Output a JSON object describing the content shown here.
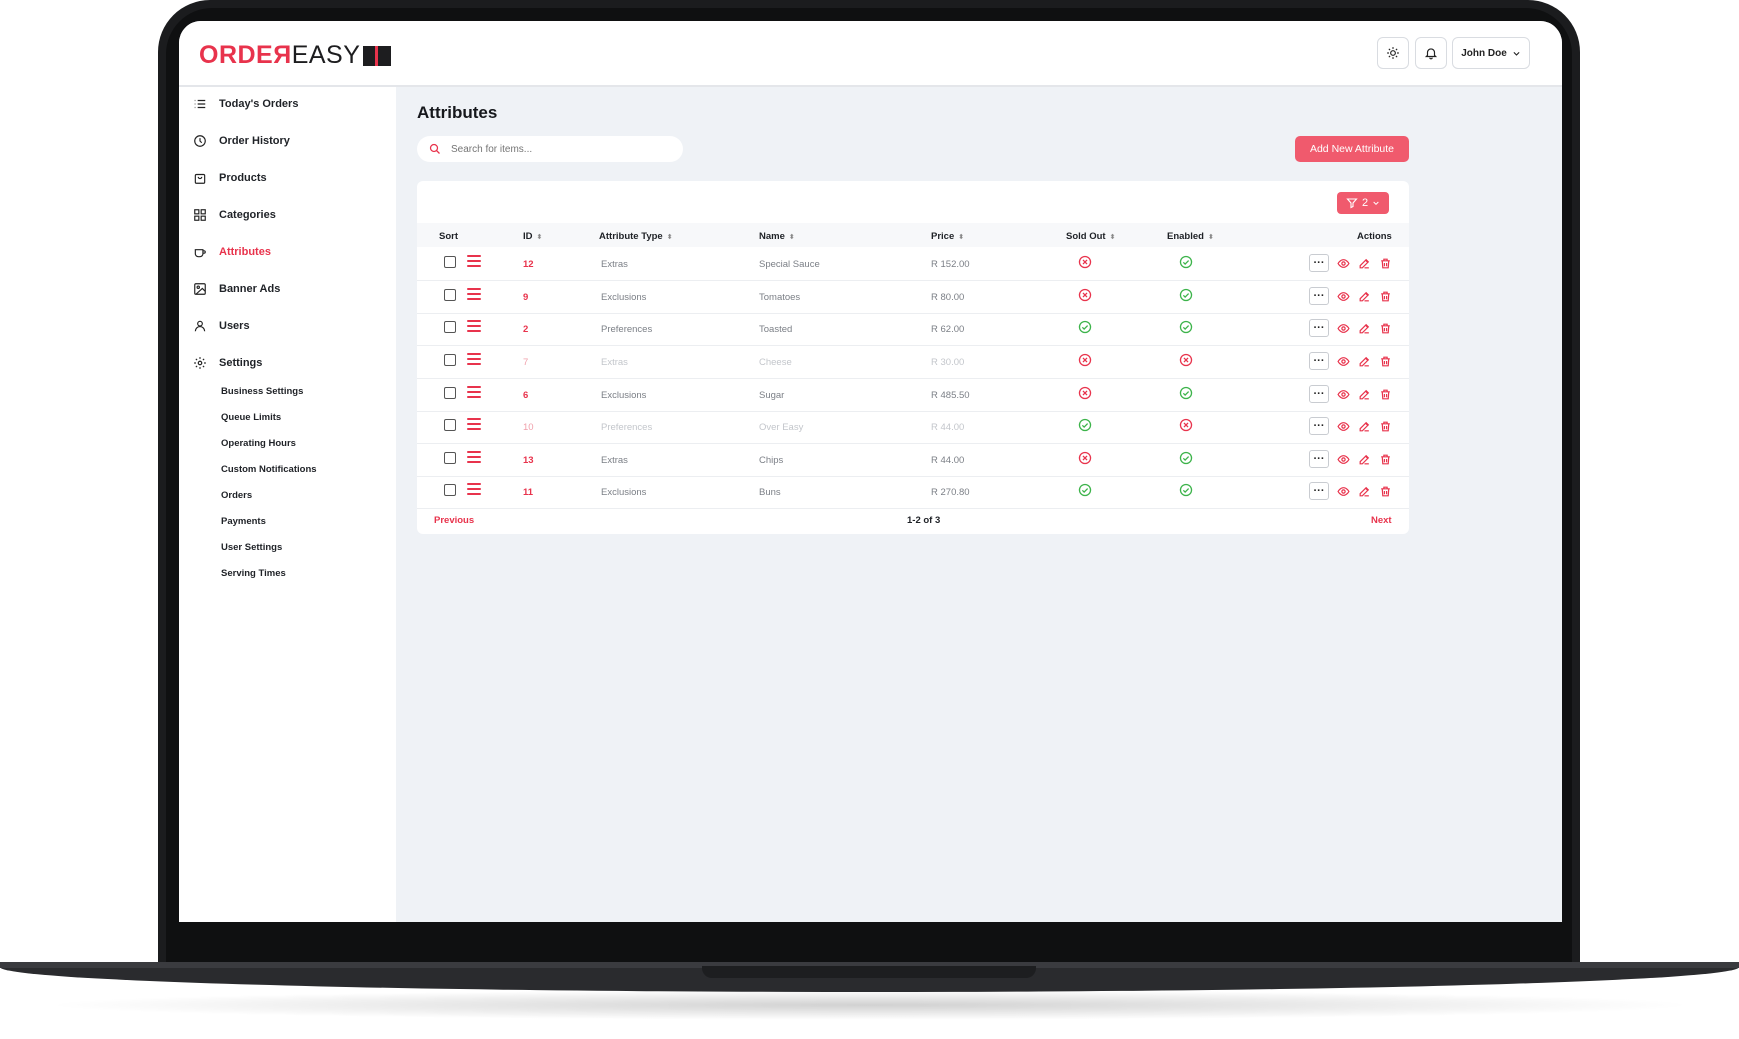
{
  "app": {
    "logo_order": "ORDEЯ",
    "logo_easy": "EASY",
    "user_name": "John Doe"
  },
  "sidebar": {
    "items": [
      {
        "label": "Today's Orders",
        "icon": "list-icon"
      },
      {
        "label": "Order History",
        "icon": "clock-icon"
      },
      {
        "label": "Products",
        "icon": "bag-icon"
      },
      {
        "label": "Categories",
        "icon": "grid-icon"
      },
      {
        "label": "Attributes",
        "icon": "cup-icon"
      },
      {
        "label": "Banner Ads",
        "icon": "image-icon"
      },
      {
        "label": "Users",
        "icon": "user-icon"
      },
      {
        "label": "Settings",
        "icon": "gear-icon"
      }
    ],
    "sub_items": [
      "Business Settings",
      "Queue Limits",
      "Operating Hours",
      "Custom Notifications",
      "Orders",
      "Payments",
      "User Settings",
      "Serving Times"
    ]
  },
  "main": {
    "title": "Attributes",
    "search_placeholder": "Search for items...",
    "add_button": "Add New Attribute",
    "filter_count": "2"
  },
  "table": {
    "columns": [
      "Sort",
      "ID",
      "Attribute Type",
      "Name",
      "Price",
      "Sold Out",
      "Enabled",
      "Actions"
    ],
    "rows": [
      {
        "id": "12",
        "type": "Extras",
        "name": "Special Sauce",
        "price": "R 152.00",
        "sold_out": false,
        "enabled": true,
        "dim": false
      },
      {
        "id": "9",
        "type": "Exclusions",
        "name": "Tomatoes",
        "price": "R 80.00",
        "sold_out": false,
        "enabled": true,
        "dim": false
      },
      {
        "id": "2",
        "type": "Preferences",
        "name": "Toasted",
        "price": "R 62.00",
        "sold_out": true,
        "enabled": true,
        "dim": false
      },
      {
        "id": "7",
        "type": "Extras",
        "name": "Cheese",
        "price": "R 30.00",
        "sold_out": false,
        "enabled": false,
        "dim": true
      },
      {
        "id": "6",
        "type": "Exclusions",
        "name": "Sugar",
        "price": "R 485.50",
        "sold_out": false,
        "enabled": true,
        "dim": false
      },
      {
        "id": "10",
        "type": "Preferences",
        "name": "Over Easy",
        "price": "R 44.00",
        "sold_out": true,
        "enabled": false,
        "dim": true
      },
      {
        "id": "13",
        "type": "Extras",
        "name": "Chips",
        "price": "R 44.00",
        "sold_out": false,
        "enabled": true,
        "dim": false
      },
      {
        "id": "11",
        "type": "Exclusions",
        "name": "Buns",
        "price": "R 270.80",
        "sold_out": true,
        "enabled": true,
        "dim": false
      }
    ],
    "pagination": {
      "previous": "Previous",
      "info": "1-2 of 3",
      "next": "Next"
    }
  },
  "colors": {
    "accent": "#e8334c",
    "button": "#f05a6d",
    "ok": "#3cb34a",
    "bad": "#e8334c"
  }
}
